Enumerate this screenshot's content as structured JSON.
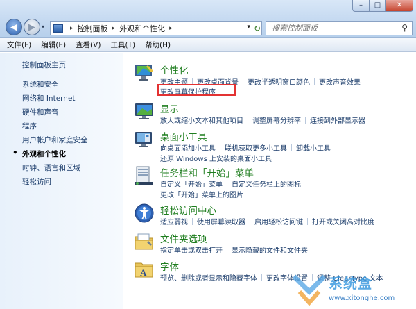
{
  "window": {
    "controls": [
      "–",
      "□",
      "✕"
    ]
  },
  "nav": {
    "back_icon": "back-arrow-icon",
    "forward_icon": "forward-arrow-icon"
  },
  "address": {
    "crumbs": [
      "控制面板",
      "外观和个性化"
    ]
  },
  "search": {
    "placeholder": "搜索控制面板"
  },
  "menu": [
    "文件(F)",
    "编辑(E)",
    "查看(V)",
    "工具(T)",
    "帮助(H)"
  ],
  "sidebar": {
    "home": "控制面板主页",
    "items": [
      "系统和安全",
      "网络和 Internet",
      "硬件和声音",
      "程序",
      "用户帐户和家庭安全",
      "外观和个性化",
      "时钟、语言和区域",
      "轻松访问"
    ],
    "active_index": 5
  },
  "categories": [
    {
      "title": "个性化",
      "icon": "personalization-icon",
      "lines": [
        [
          "更改主题",
          "更改桌面背景",
          "更改半透明窗口颜色",
          "更改声音效果"
        ],
        [
          "更改屏幕保护程序"
        ]
      ]
    },
    {
      "title": "显示",
      "icon": "display-icon",
      "lines": [
        [
          "放大或缩小文本和其他项目",
          "调整屏幕分辨率",
          "连接到外部显示器"
        ]
      ]
    },
    {
      "title": "桌面小工具",
      "icon": "gadgets-icon",
      "lines": [
        [
          "向桌面添加小工具",
          "联机获取更多小工具",
          "卸载小工具"
        ],
        [
          "还原 Windows 上安装的桌面小工具"
        ]
      ]
    },
    {
      "title": "任务栏和「开始」菜单",
      "icon": "taskbar-icon",
      "lines": [
        [
          "自定义「开始」菜单",
          "自定义任务栏上的图标"
        ],
        [
          "更改「开始」菜单上的图片"
        ]
      ]
    },
    {
      "title": "轻松访问中心",
      "icon": "ease-of-access-icon",
      "lines": [
        [
          "适应弱视",
          "使用屏幕读取器",
          "启用轻松访问键",
          "打开或关闭高对比度"
        ]
      ]
    },
    {
      "title": "文件夹选项",
      "icon": "folder-options-icon",
      "lines": [
        [
          "指定单击或双击打开",
          "显示隐藏的文件和文件夹"
        ]
      ]
    },
    {
      "title": "字体",
      "icon": "fonts-icon",
      "lines": [
        [
          "预览、删除或者显示和隐藏字体",
          "更改字体设置",
          "调整 ClearType 文本"
        ]
      ]
    }
  ],
  "watermark": {
    "text": "系统盒",
    "url": "www.xitonghe.com"
  },
  "colors": {
    "link": "#1c3d6b",
    "category_title": "#1e7d1e",
    "highlight": "#e33232"
  }
}
